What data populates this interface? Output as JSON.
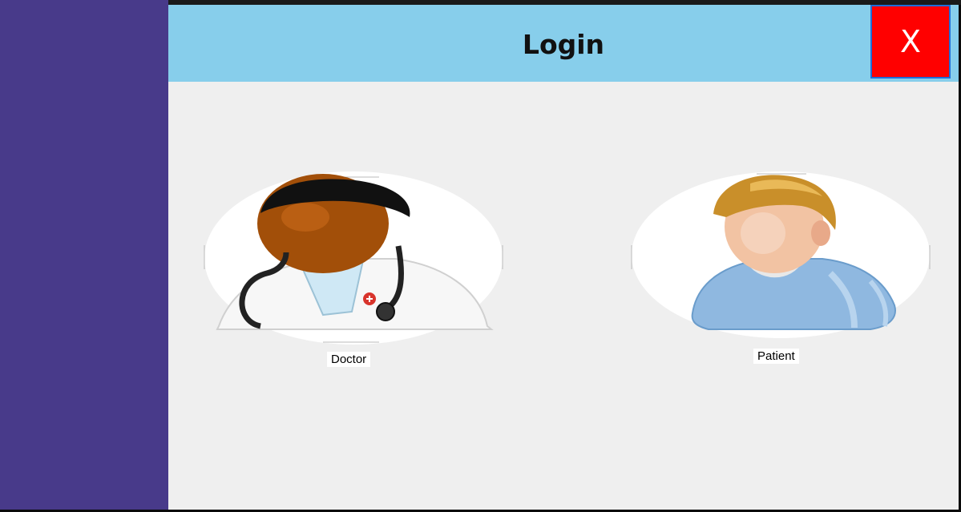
{
  "header": {
    "title": "Login",
    "close_label": "X"
  },
  "roles": [
    {
      "label": "Doctor"
    },
    {
      "label": "Patient"
    }
  ],
  "colors": {
    "sidebar": "#483a8a",
    "header": "#87ceeb",
    "close_button": "#ff0000",
    "window_background": "#efefef"
  }
}
